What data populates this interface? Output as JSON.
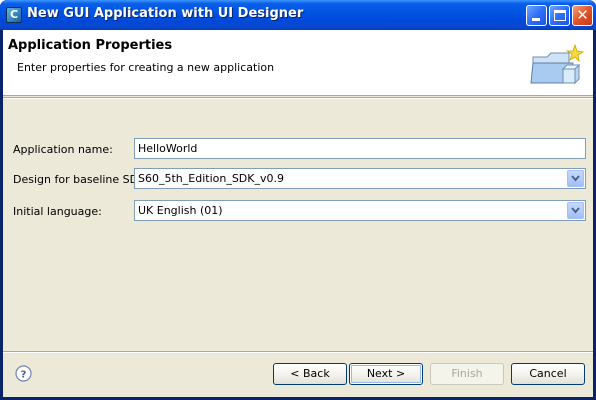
{
  "window": {
    "title": "New GUI Application with UI Designer",
    "app_icon": "C",
    "controls": [
      "minimize-icon",
      "maximize-icon",
      "close-icon"
    ]
  },
  "banner": {
    "title": "Application Properties",
    "subtitle": "Enter properties for creating a new application",
    "icon": "new-folder-wizard-icon"
  },
  "form": {
    "app_name": {
      "label": "Application name:",
      "value": "HelloWorld"
    },
    "sdk": {
      "label": "Design for baseline SDK:",
      "value": "S60_5th_Edition_SDK_v0.9"
    },
    "language": {
      "label": "Initial language:",
      "value": "UK English (01)"
    }
  },
  "buttons": {
    "back": "< Back",
    "next": "Next >",
    "finish": "Finish",
    "cancel": "Cancel"
  },
  "colors": {
    "titlebar": "#0055e5",
    "dialog_bg": "#ece9d8",
    "field_border": "#7f9db9",
    "button_border": "#003c74"
  }
}
